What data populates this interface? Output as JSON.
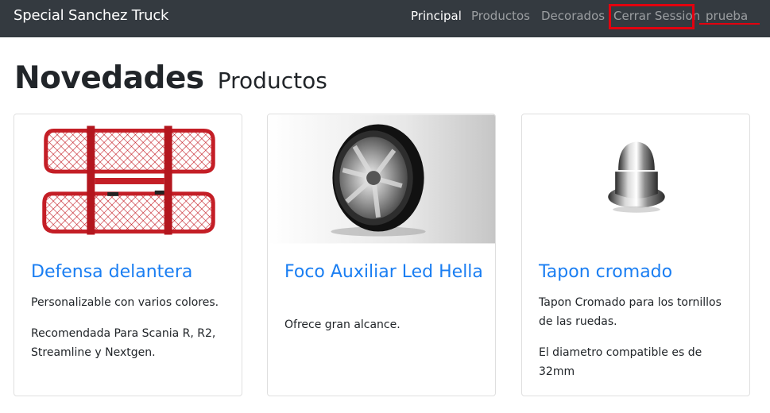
{
  "navbar": {
    "brand": "Special Sanchez Truck",
    "links": [
      {
        "label": "Principal",
        "active": true
      },
      {
        "label": "Productos",
        "active": false
      },
      {
        "label": "Decorados",
        "active": false
      },
      {
        "label": "Cerrar Session",
        "active": false
      },
      {
        "label": "prueba",
        "active": false
      }
    ]
  },
  "heading": {
    "main": "Novedades",
    "sub": "Productos"
  },
  "products": [
    {
      "title": "Defensa delantera",
      "paragraphs": [
        "Personalizable con varios colores.",
        "Recomendada Para Scania R, R2, Streamline y Nextgen."
      ],
      "image": "red-mesh-front-guard"
    },
    {
      "title": "Foco Auxiliar Led Hella",
      "paragraphs": [
        "Ofrece gran alcance."
      ],
      "image": "round-led-spotlight"
    },
    {
      "title": "Tapon cromado",
      "paragraphs": [
        "Tapon Cromado para los tornillos de las ruedas.",
        "El diametro compatible es de 32mm"
      ],
      "image": "chrome-nut-cap"
    }
  ],
  "colors": {
    "navbar_bg": "#343a40",
    "link_blue": "#1a7ef2",
    "annotation_red": "#e3000f"
  }
}
